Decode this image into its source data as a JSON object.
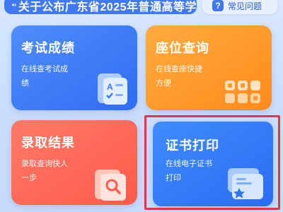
{
  "notice": {
    "text": "关于公布广东省2025年普通高等学",
    "icon": "speaker-icon"
  },
  "faq": {
    "icon_text": "?",
    "label": "常见问题"
  },
  "tiles": [
    {
      "title": "考试成绩",
      "subtitle": "在线查考试成绩",
      "icon": "score-sheet-icon",
      "color": "#3b7bf5"
    },
    {
      "title": "座位查询",
      "subtitle": "在线查座快捷方便",
      "icon": "seat-grid-icon",
      "color": "#ff9a2e"
    },
    {
      "title": "录取结果",
      "subtitle": "录取查询快人一步",
      "icon": "magnifier-doc-icon",
      "color": "#ff6a58"
    },
    {
      "title": "证书打印",
      "subtitle": "在线电子证书打印",
      "icon": "certificate-icon",
      "color": "#2f74f6"
    }
  ],
  "highlight_color": "#e0393a"
}
